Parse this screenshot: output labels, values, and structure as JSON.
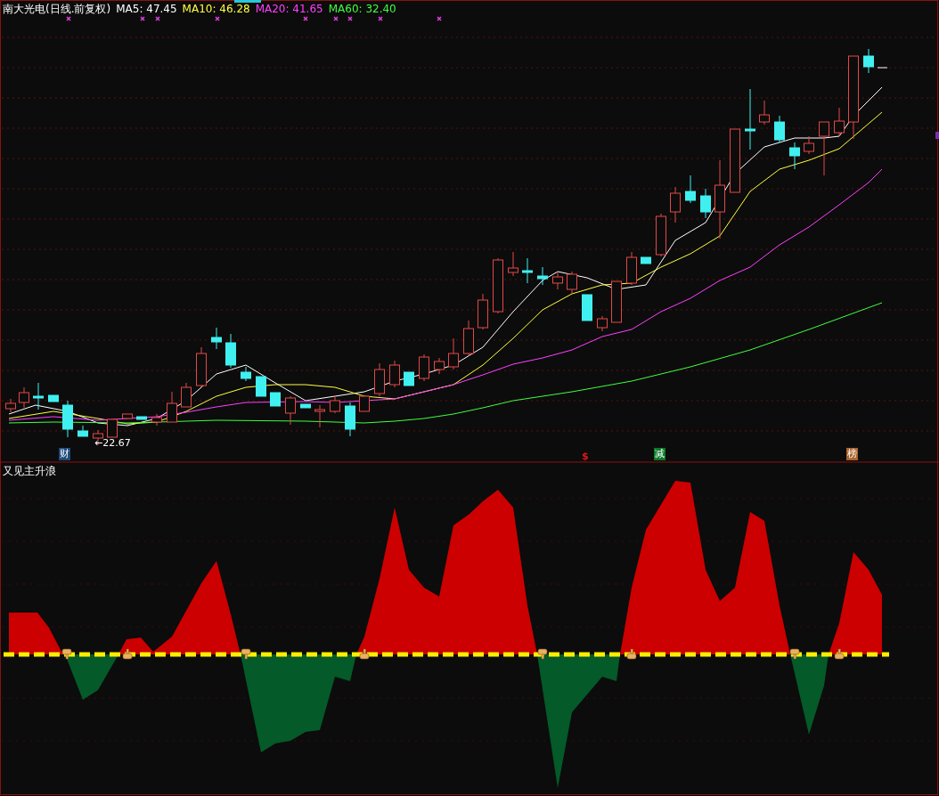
{
  "title": "南大光电(日线.前复权)",
  "moving_averages": [
    {
      "label": "MA5:",
      "value": "47.45",
      "color": "#ffffff"
    },
    {
      "label": "MA10:",
      "value": "46.28",
      "color": "#ffff40"
    },
    {
      "label": "MA20:",
      "value": "41.65",
      "color": "#ff40ff"
    },
    {
      "label": "MA60:",
      "value": "32.40",
      "color": "#40ff40"
    }
  ],
  "low_marker": {
    "arrow": "←",
    "value": "22.67"
  },
  "event_tags": [
    {
      "label": "财",
      "kind": "badge",
      "color": "#1e4b7a"
    },
    {
      "label": "$",
      "kind": "plain",
      "color": "#e01818"
    },
    {
      "label": "减",
      "kind": "badge",
      "color": "#0a7a28"
    },
    {
      "label": "榜",
      "kind": "badge",
      "color": "#a8642c"
    }
  ],
  "indicator": {
    "title": "又见主升浪"
  }
}
